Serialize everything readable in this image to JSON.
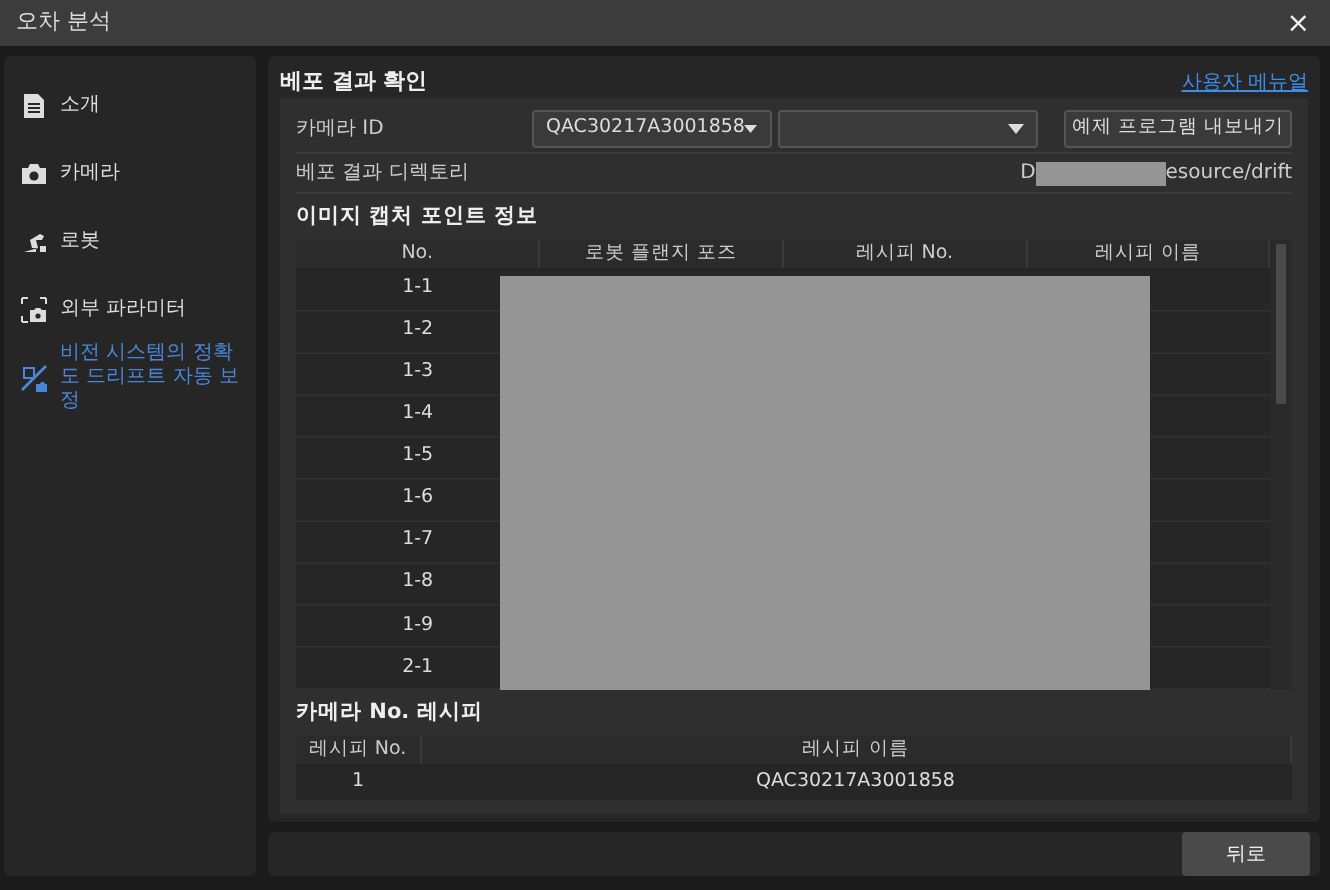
{
  "window": {
    "title": "오차 분석",
    "close": "×"
  },
  "sidebar": {
    "items": [
      {
        "label": "소개",
        "selected": false
      },
      {
        "label": "카메라",
        "selected": false
      },
      {
        "label": "로봇",
        "selected": false
      },
      {
        "label": "외부 파라미터",
        "selected": false
      },
      {
        "label": "비전 시스템의 정확도 드리프트 자동 보정",
        "selected": true
      }
    ]
  },
  "main": {
    "title": "베포 결과 확인",
    "manual_link": "사용자 메뉴얼",
    "camera_id": {
      "label": "카메라 ID",
      "value": "QAC30217A3001858",
      "export_button": "예제 프로그램 내보내기"
    },
    "directory": {
      "label": "베포 결과 디렉토리",
      "value_start": "D",
      "value_end": "esource/drift"
    },
    "capture_points": {
      "title": "이미지 캡처 포인트 정보",
      "columns": [
        "No.",
        "로봇 플랜지 포즈",
        "레시피 No.",
        "레시피 이름"
      ],
      "rows": [
        "1-1",
        "1-2",
        "1-3",
        "1-4",
        "1-5",
        "1-6",
        "1-7",
        "1-8",
        "1-9",
        "2-1"
      ]
    },
    "camera_recipes": {
      "title": "카메라 No. 레시피",
      "columns": [
        "레시피 No.",
        "레시피 이름"
      ],
      "rows": [
        [
          "1",
          "QAC30217A3001858"
        ]
      ]
    }
  },
  "footer": {
    "back_button": "뒤로"
  }
}
